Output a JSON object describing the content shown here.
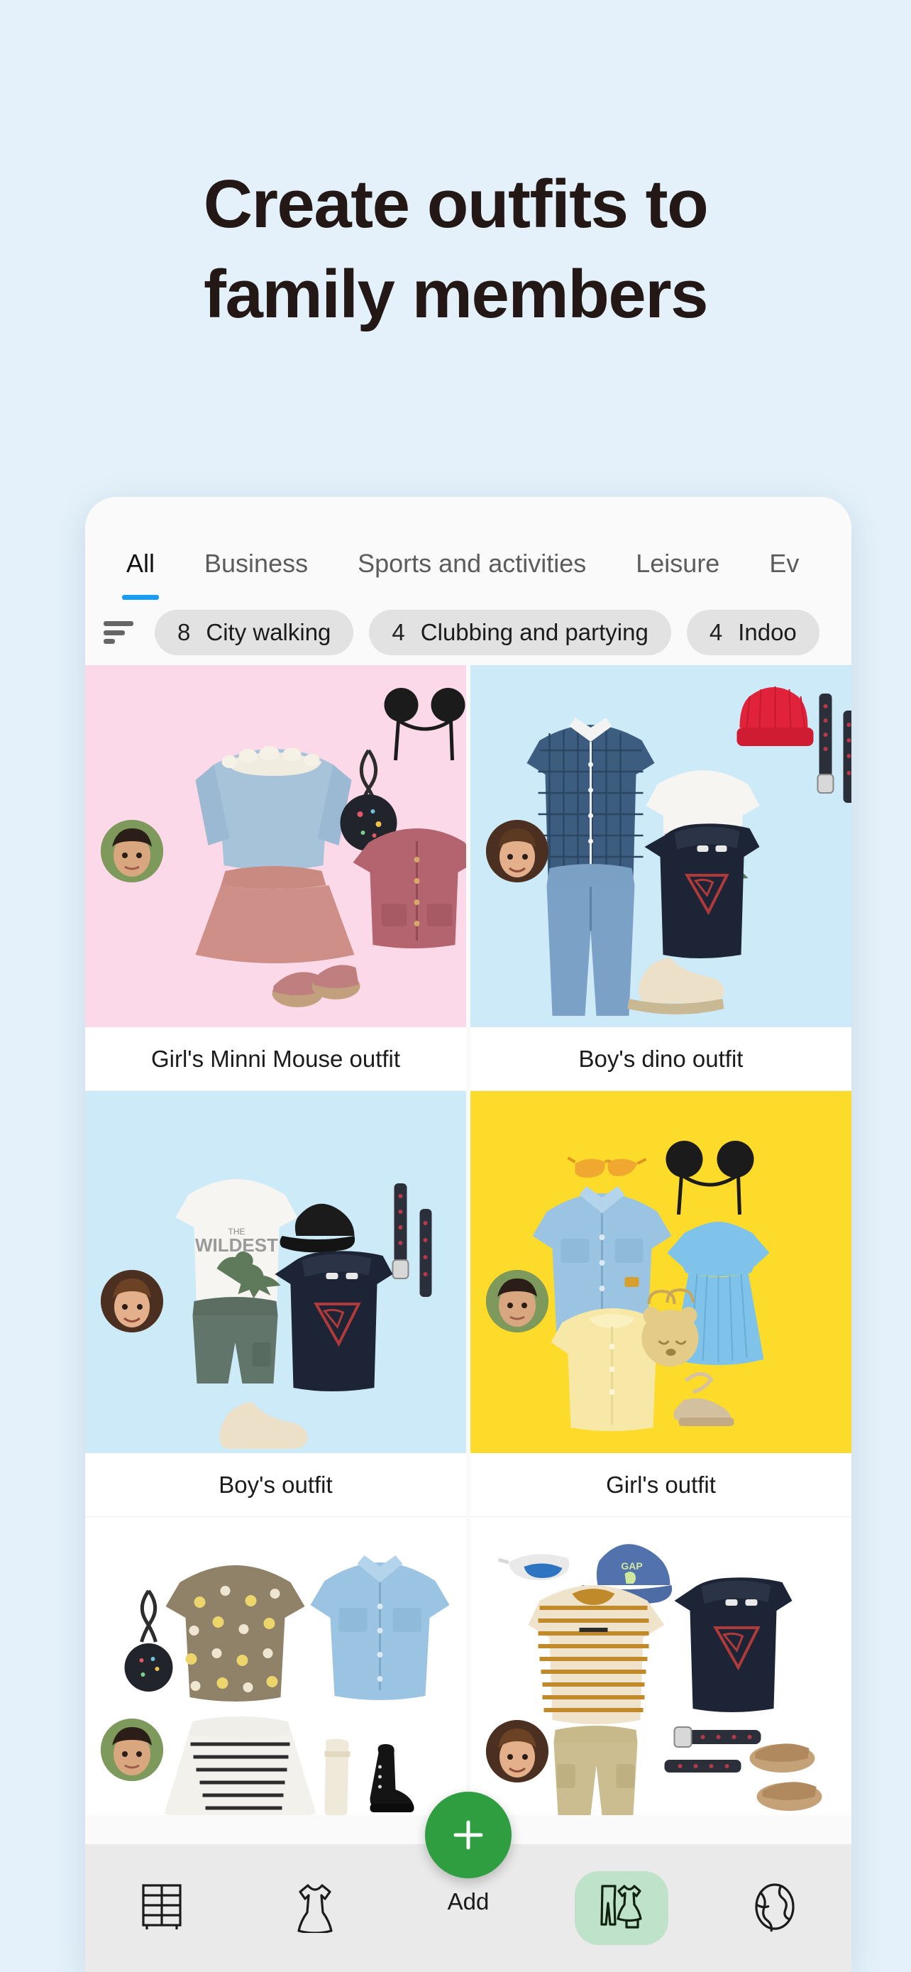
{
  "promo": {
    "headline_line1": "Create outfits to",
    "headline_line2": "family members",
    "background_color": "#e4f1fa",
    "headline_color": "#231815"
  },
  "app": {
    "tabs": [
      {
        "label": "All",
        "active": true
      },
      {
        "label": "Business",
        "active": false
      },
      {
        "label": "Sports and activities",
        "active": false
      },
      {
        "label": "Leisure",
        "active": false
      },
      {
        "label": "Ev",
        "active": false
      }
    ],
    "active_tab_indicator_color": "#1a9cf0",
    "sort_icon": "sort-icon",
    "filters": [
      {
        "count": "8",
        "label": "City walking"
      },
      {
        "count": "4",
        "label": "Clubbing and partying"
      },
      {
        "count": "4",
        "label": "Indoo"
      }
    ],
    "outfits": [
      {
        "title": "Girl's Minni Mouse outfit",
        "bg_color": "#fcd9e8",
        "avatar_name": "avatar-girl-dark-hair",
        "items": [
          "blue-ruffle-blouse",
          "rose-skirt",
          "black-round-bag",
          "mickey-ears-headband",
          "rose-cardigan",
          "rose-sandals"
        ]
      },
      {
        "title": "Boy's dino outfit",
        "bg_color": "#cdeaf8",
        "avatar_name": "avatar-boy-brown-hair",
        "items": [
          "blue-plaid-shirt",
          "blue-jeans",
          "wildest-dino-tee",
          "red-beanie",
          "navy-superman-hoodie",
          "woven-belt",
          "belt-strap",
          "beige-sneakers"
        ]
      },
      {
        "title": "Boy's outfit",
        "bg_color": "#cdeaf8",
        "avatar_name": "avatar-boy-brown-hair",
        "items": [
          "wildest-dino-tee",
          "black-cap",
          "woven-belt",
          "belt-strap",
          "green-cargo-shorts",
          "navy-superman-hoodie",
          "beige-sneakers"
        ]
      },
      {
        "title": "Girl's outfit",
        "bg_color": "#fcdb2a",
        "avatar_name": "avatar-girl-dark-hair",
        "items": [
          "yellow-sunglasses",
          "mickey-ears-headband",
          "denim-jacket",
          "blue-pleated-dress",
          "yellow-cardigan",
          "bear-straw-bag",
          "beige-espadrilles"
        ]
      },
      {
        "title": "",
        "bg_color": "#ffffff",
        "avatar_name": "avatar-girl-dark-hair",
        "items": [
          "black-round-bag",
          "floral-blouse",
          "denim-jacket",
          "striped-skirt",
          "cream-socks",
          "black-boots"
        ]
      },
      {
        "title": "",
        "bg_color": "#ffffff",
        "avatar_name": "avatar-boy-brown-hair",
        "items": [
          "white-sport-sunglasses",
          "blue-gap-cap",
          "navy-superman-hoodie",
          "striped-mustard-tee",
          "khaki-cargo-pants",
          "woven-belt",
          "belt-strap",
          "brown-sandals"
        ]
      }
    ],
    "fab": {
      "label": "Add",
      "icon": "plus-icon",
      "color": "#2e9e41"
    },
    "nav": [
      {
        "icon": "wardrobe-icon",
        "active": false
      },
      {
        "icon": "dress-icon",
        "active": false
      },
      {
        "icon": "outfits-icon",
        "active": true
      },
      {
        "icon": "globe-icon",
        "active": false
      }
    ],
    "nav_active_color": "#bfe2cb"
  }
}
